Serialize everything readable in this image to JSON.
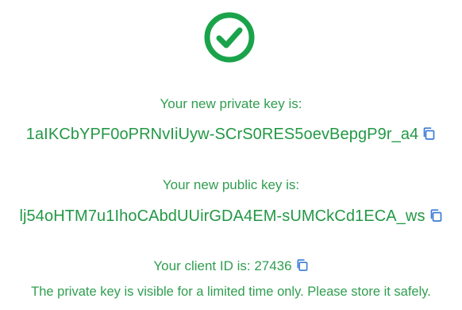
{
  "private_key": {
    "label": "Your new private key is:",
    "value": "1aIKCbYPF0oPRNvIiUyw-SCrS0RES5oevBepgP9r_a4",
    "copy_icon": "copy-icon"
  },
  "public_key": {
    "label": "Your new public key is:",
    "value": "lj54oHTM7u1IhoCAbdUUirGDA4EM-sUMCkCd1ECA_ws",
    "copy_icon": "copy-icon"
  },
  "client_id": {
    "label": "Your client ID is: 27436",
    "copy_icon": "copy-icon"
  },
  "notice": "The private key is visible for a limited time only. Please store it safely.",
  "icons": {
    "success": "check-circle-icon"
  },
  "colors": {
    "success_green": "#1aa34a",
    "text_green": "#2f9e4f",
    "copy_icon_blue": "#3a7bd5"
  }
}
